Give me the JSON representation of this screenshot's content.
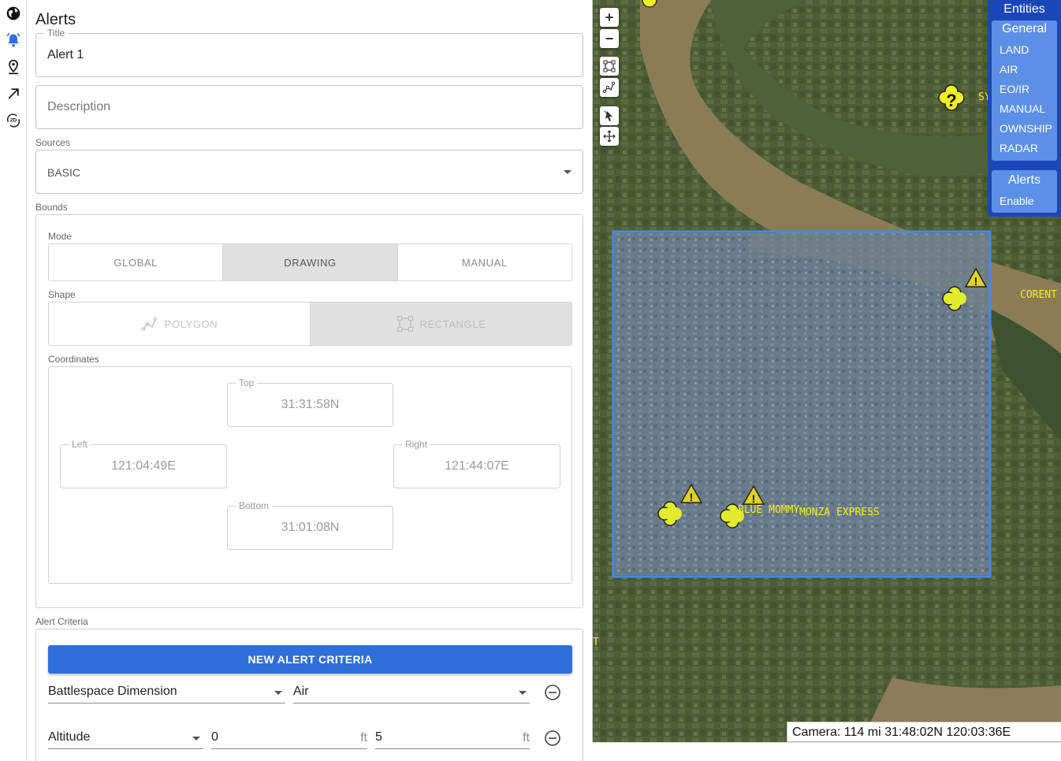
{
  "sidebar": {
    "icons": [
      "globe-icon",
      "bell-icon",
      "location-pin-icon",
      "arrow-up-right-icon",
      "2d-rotate-icon"
    ],
    "badge_2d": "2D"
  },
  "panel": {
    "title": "Alerts",
    "title_field": {
      "label": "Title",
      "value": "Alert 1"
    },
    "description_field": {
      "placeholder": "Description"
    },
    "sources": {
      "label": "Sources",
      "value": "BASIC"
    },
    "bounds": {
      "label": "Bounds",
      "mode_label": "Mode",
      "modes": [
        "GLOBAL",
        "DRAWING",
        "MANUAL"
      ],
      "active_mode": "DRAWING",
      "shape_label": "Shape",
      "shapes": [
        "POLYGON",
        "RECTANGLE"
      ],
      "active_shape": "RECTANGLE",
      "coordinates_label": "Coordinates",
      "top": {
        "label": "Top",
        "value": "31:31:58N"
      },
      "left": {
        "label": "Left",
        "value": "121:04:49E"
      },
      "right": {
        "label": "Right",
        "value": "121:44:07E"
      },
      "bottom": {
        "label": "Bottom",
        "value": "31:01:08N"
      }
    },
    "alert_criteria": {
      "label": "Alert Criteria",
      "new_button": "NEW ALERT CRITERIA",
      "row1": {
        "criterion": "Battlespace Dimension",
        "value": "Air"
      },
      "row2": {
        "criterion": "Altitude",
        "min": "0",
        "max": "5",
        "unit": "ft"
      }
    }
  },
  "map": {
    "zoom_in": "+",
    "zoom_out": "−",
    "entities_panel": {
      "title": "Entities",
      "general_title": "General",
      "items": [
        "LAND",
        "AIR",
        "EO/IR",
        "MANUAL",
        "OWNSHIP",
        "RADAR"
      ],
      "alerts_title": "Alerts",
      "alerts_items": [
        "Enable"
      ]
    },
    "labels": {
      "sy": "SY",
      "corent": "CORENT",
      "blue_mommy": "BLUE MOMMY",
      "monza_express": "MONZA EXPRESS",
      "t": "T"
    },
    "camera": "Camera: 114 mi 31:48:02N 120:03:36E",
    "colors": {
      "marker": "#f1ee24",
      "selection": "#4a86e8",
      "panel": "#1a47b8"
    }
  }
}
